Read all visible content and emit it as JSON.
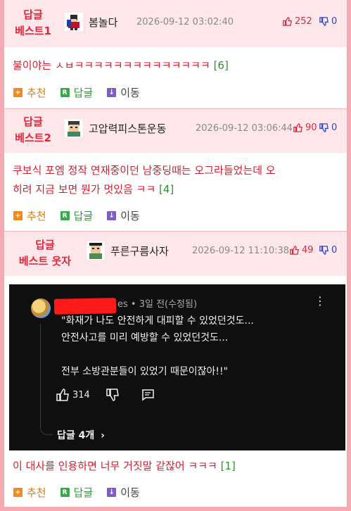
{
  "comments": [
    {
      "badge_line1": "답글",
      "badge_line2": "베스트1",
      "nickname": "봄놀다",
      "date": "2026-09-12 03:02:40",
      "up": "252",
      "down": "0",
      "text": "불이야는 ㅅㅂㅋㅋㅋㅋㅋㅋㅋㅋㅋㅋㅋㅋㅋㅋ",
      "reply_count": "[6]"
    },
    {
      "badge_line1": "답글",
      "badge_line2": "베스트2",
      "nickname": "고압력피스톤운동",
      "date": "2026-09-12 03:06:44",
      "up": "90",
      "down": "0",
      "text_line1": "쿠보식 포엠 정작 연재중이던 남중딩때는 오그라들었는데 오",
      "text_line2": "히려 지금 보면 뭔가 멋있음 ㅋㅋ",
      "reply_count": "[4]"
    },
    {
      "badge_line1": "답글",
      "badge_line2": "베스트 웃자",
      "nickname": "푸른구름사자",
      "date": "2026-09-12 11:10:38",
      "up": "49",
      "down": "0",
      "text": "이 대사를 인용하면 너무 거짓말 같잖어 ㅋㅋㅋ",
      "reply_count": "[1]"
    }
  ],
  "actions": {
    "recommend": "추천",
    "reply": "답글",
    "move": "이동",
    "recommend_icon": "+",
    "reply_icon": "R",
    "move_icon": "↓"
  },
  "embedded_screenshot": {
    "meta": "es • 3일 전(수정됨)",
    "quote_line1": "\"화재가 나도 안전하게 대피할 수 있었던것도...",
    "quote_line2": "안전사고를 미리 예방할 수 있었던것도...",
    "quote_line3": "전부 소방관분들이 있었기 때문이잖아!!\"",
    "likes": "314",
    "replies": "답글 4개"
  },
  "colors": {
    "accent_red": "#e0283b",
    "upvote": "#d12c3c",
    "downvote": "#2a46c8",
    "reply_count_green": "#2f8f2f",
    "border_pink": "#f4a9b3"
  }
}
